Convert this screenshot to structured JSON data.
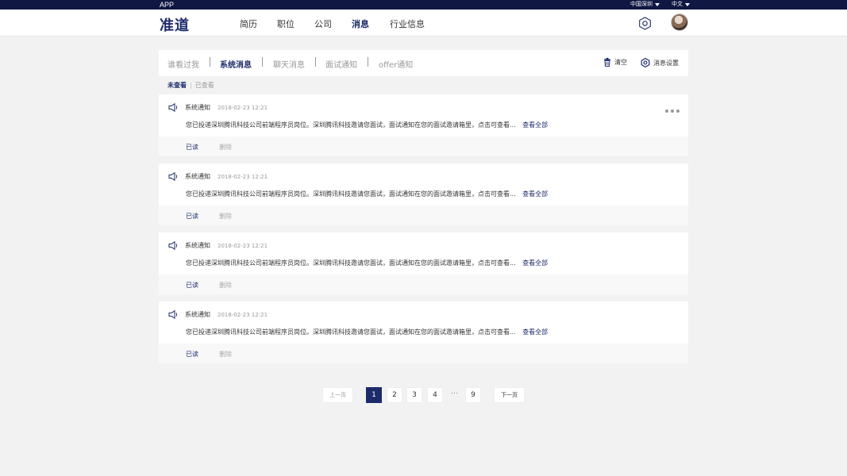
{
  "topbar": {
    "app_label": "APP",
    "city_label": "中国深圳",
    "lang_label": "中文"
  },
  "nav": {
    "logo": "准道",
    "items": [
      "简历",
      "职位",
      "公司",
      "消息",
      "行业信息"
    ],
    "active": "消息"
  },
  "tabs": {
    "items": [
      "谁看过我",
      "系统消息",
      "聊天消息",
      "面试通知",
      "offer通知"
    ],
    "active": "系统消息",
    "clear_label": "清空",
    "settings_label": "消息设置"
  },
  "filters": {
    "unread": "未查看",
    "separator": "|",
    "read": "已查看"
  },
  "messages": [
    {
      "title": "系统通知",
      "time": "2018-02-23 12:21",
      "body": "您已投递深圳腾讯科技公司前端程序员岗位。深圳腾讯科技邀请您面试，面试通知在您的面试邀请箱里，点击可查看...",
      "more": "查看全部",
      "read_label": "已读",
      "delete_label": "删除"
    },
    {
      "title": "系统通知",
      "time": "2018-02-23 12:21",
      "body": "您已投递深圳腾讯科技公司前端程序员岗位。深圳腾讯科技邀请您面试，面试通知在您的面试邀请箱里，点击可查看...",
      "more": "查看全部",
      "read_label": "已读",
      "delete_label": "删除"
    },
    {
      "title": "系统通知",
      "time": "2018-02-23 12:21",
      "body": "您已投递深圳腾讯科技公司前端程序员岗位。深圳腾讯科技邀请您面试，面试通知在您的面试邀请箱里，点击可查看...",
      "more": "查看全部",
      "read_label": "已读",
      "delete_label": "删除"
    },
    {
      "title": "系统通知",
      "time": "2018-02-23 12:21",
      "body": "您已投递深圳腾讯科技公司前端程序员岗位。深圳腾讯科技邀请您面试，面试通知在您的面试邀请箱里，点击可查看...",
      "more": "查看全部",
      "read_label": "已读",
      "delete_label": "删除"
    }
  ],
  "pagination": {
    "prev": "上一页",
    "pages": [
      "1",
      "2",
      "3",
      "4"
    ],
    "ellipsis": "···",
    "last": "9",
    "next": "下一页",
    "current": "1"
  },
  "colors": {
    "brand": "#1d2b6b",
    "topbar": "#0f1742",
    "background": "#f2f2f2"
  }
}
